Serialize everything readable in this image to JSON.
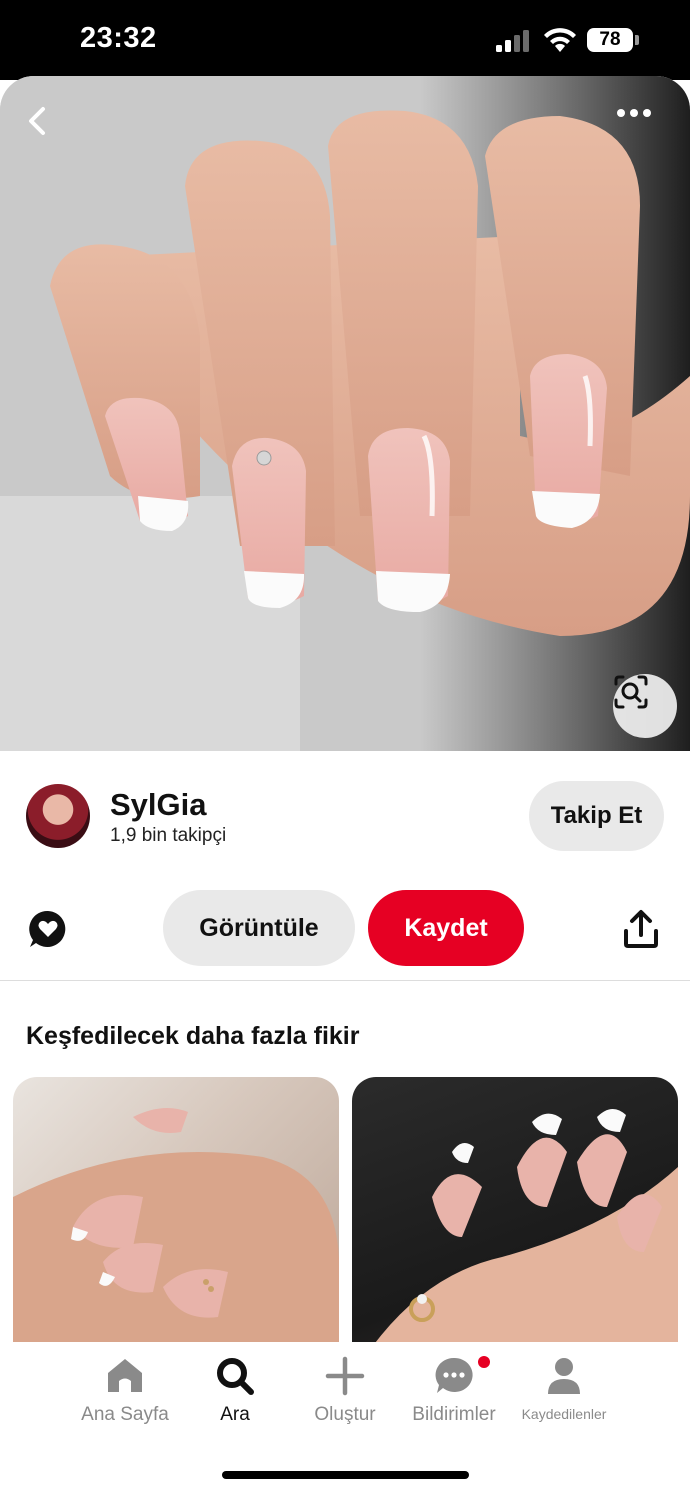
{
  "status_bar": {
    "time": "23:32",
    "battery": "78"
  },
  "pin": {
    "image_alt": "French manicure nails",
    "icons": {
      "back": "chevron-left-icon",
      "more": "more-horizontal-icon",
      "visual_search": "lens-icon"
    }
  },
  "creator": {
    "name": "SylGia",
    "followers": "1,9 bin takipçi",
    "follow_label": "Takip Et"
  },
  "actions": {
    "view_label": "Görüntüle",
    "save_label": "Kaydet",
    "save_color": "#e60023"
  },
  "more_ideas": {
    "title": "Keşfedilecek daha fazla fikir"
  },
  "nav": {
    "items": [
      {
        "label": "Ana Sayfa",
        "icon": "home-icon"
      },
      {
        "label": "Ara",
        "icon": "search-icon"
      },
      {
        "label": "Oluştur",
        "icon": "plus-icon"
      },
      {
        "label": "Bildirimler",
        "icon": "chat-bubble-icon"
      },
      {
        "label": "Kaydedilenler",
        "icon": "profile-icon"
      }
    ],
    "active": "Ara"
  }
}
